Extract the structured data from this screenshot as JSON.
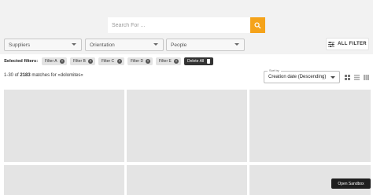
{
  "search": {
    "placeholder": "Search For ..."
  },
  "filters": {
    "suppliers": "Suppliers",
    "orientation": "Orientation",
    "people": "People",
    "all_filter": "ALL FILTER"
  },
  "selected_filters": {
    "label": "Selected filters:",
    "chips": [
      "Filter A",
      "Filter B",
      "Filter C",
      "Filter D",
      "Filter E"
    ],
    "delete_all": "Delete All"
  },
  "results": {
    "range": "1-30 of",
    "total": "2183",
    "matches_text": "matches for »dolomites«"
  },
  "sort": {
    "label": "Sort by",
    "value": "Creation date (Descending)"
  },
  "sandbox": {
    "label": "Open Sandbox"
  },
  "colors": {
    "accent": "#f5a31a",
    "dark": "#333333"
  },
  "icons": [
    "search-icon",
    "sliders-icon",
    "close-icon",
    "trash-icon",
    "grid-view-icon",
    "list-view-icon",
    "compact-view-icon"
  ]
}
